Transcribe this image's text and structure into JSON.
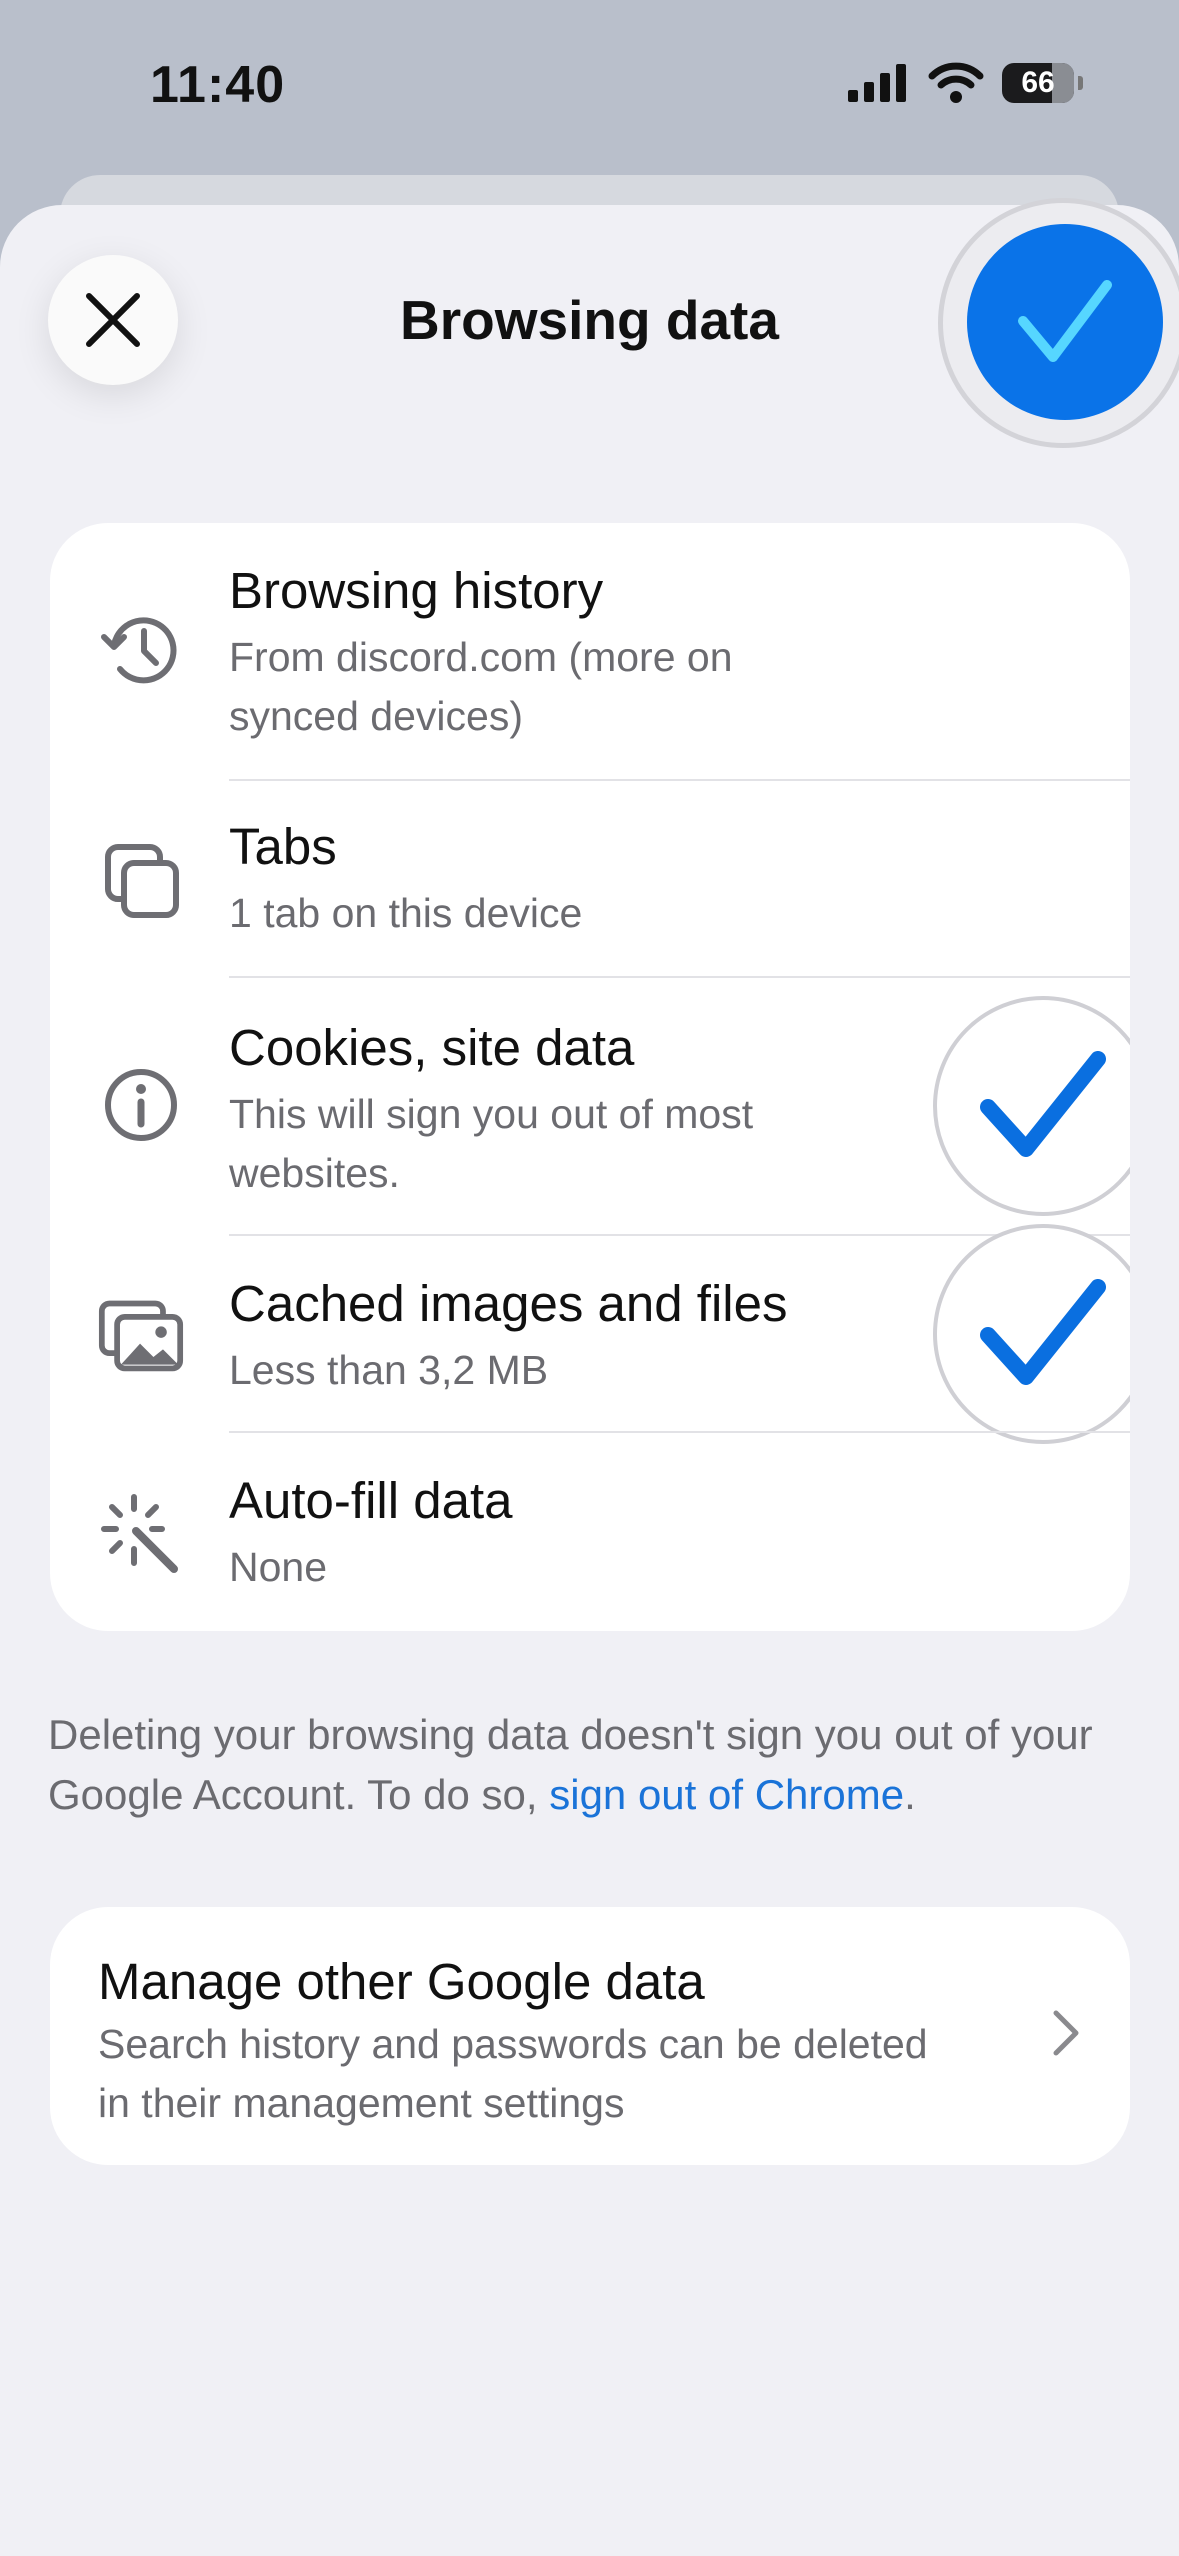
{
  "status_bar": {
    "time": "11:40",
    "battery": "66"
  },
  "header": {
    "title": "Browsing data"
  },
  "items": [
    {
      "title": "Browsing history",
      "subtitle": "From discord.com (more on synced devices)",
      "icon": "history-icon",
      "checked": false
    },
    {
      "title": "Tabs",
      "subtitle": "1 tab on this device",
      "icon": "tabs-icon",
      "checked": false
    },
    {
      "title": "Cookies, site data",
      "subtitle": "This will sign you out of most websites.",
      "icon": "info-icon",
      "checked": true
    },
    {
      "title": "Cached images and files",
      "subtitle": "Less than 3,2 MB",
      "icon": "images-icon",
      "checked": true
    },
    {
      "title": "Auto-fill data",
      "subtitle": "None",
      "icon": "autofill-icon",
      "checked": false
    }
  ],
  "note": {
    "text": "Deleting your browsing data doesn't sign you out of your Google Account. To do so, ",
    "link": "sign out of Chrome",
    "end": "."
  },
  "manage": {
    "title": "Manage other Google data",
    "subtitle": "Search history and passwords can be deleted in their management settings"
  },
  "colors": {
    "accent": "#0a73e8",
    "link": "#1a73d8",
    "background": "#f0f0f5"
  }
}
